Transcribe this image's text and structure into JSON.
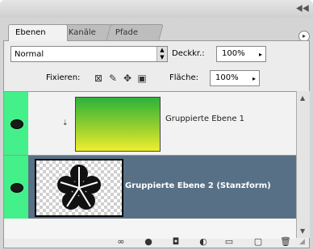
{
  "tabs": [
    {
      "label": "Ebenen",
      "active": true
    },
    {
      "label": "Kanäle",
      "active": false
    },
    {
      "label": "Pfade",
      "active": false
    }
  ],
  "blend_mode": {
    "value": "Normal"
  },
  "opacity": {
    "label": "Deckkr.:",
    "value": "100%"
  },
  "fill": {
    "label": "Fläche:",
    "value": "100%"
  },
  "lock": {
    "label": "Fixieren:"
  },
  "layers": [
    {
      "name": "Gruppierte Ebene 1",
      "visible": true,
      "selected": false
    },
    {
      "name": "Gruppierte Ebene 2 (Stanzform)",
      "visible": true,
      "selected": true
    }
  ],
  "colors": {
    "eye_column": "#44f08a",
    "selected_row": "#587086"
  }
}
